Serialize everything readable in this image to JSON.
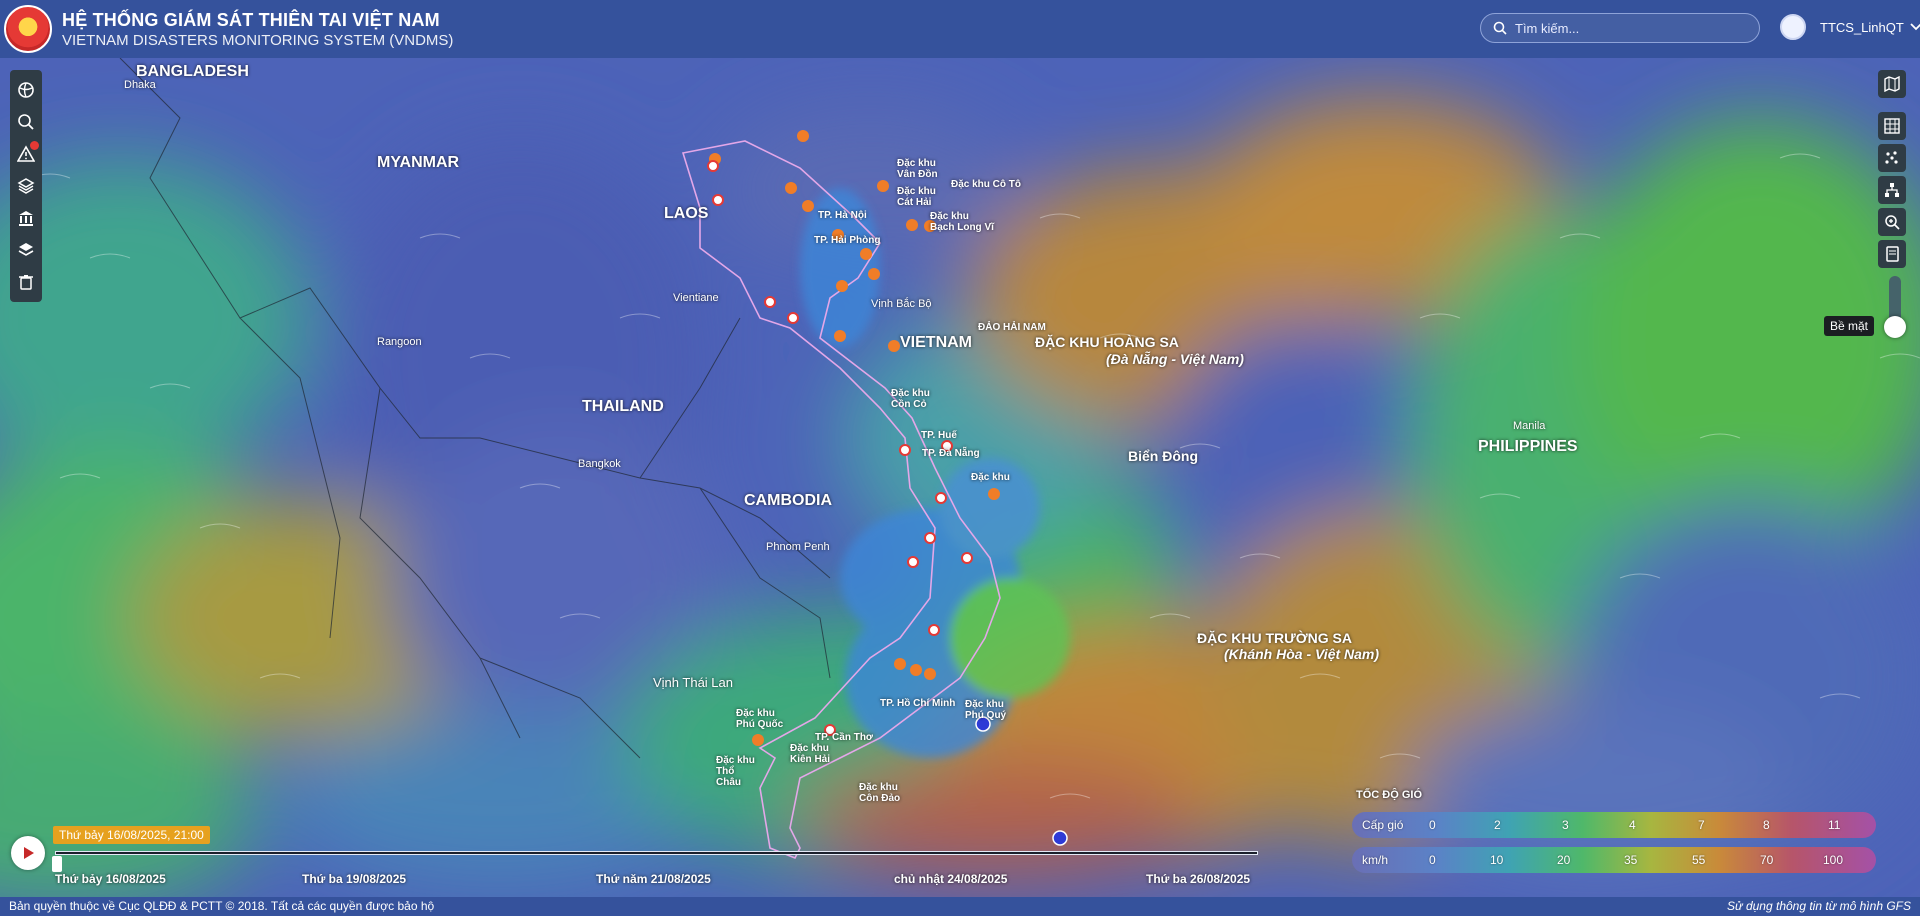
{
  "header": {
    "title": "HỆ THỐNG GIÁM SÁT THIÊN TAI VIỆT NAM",
    "subtitle": "VIETNAM DISASTERS MONITORING SYSTEM (VNDMS)",
    "search_placeholder": "Tìm kiếm...",
    "username": "TTCS_LinhQT"
  },
  "map_labels": {
    "bangladesh": "BANGLADESH",
    "dhaka": "Dhaka",
    "myanmar": "MYANMAR",
    "laos": "LAOS",
    "vientiane": "Vientiane",
    "rangoon": "Rangoon",
    "thailand": "THAILAND",
    "bangkok": "Bangkok",
    "cambodia": "CAMBODIA",
    "phnom_penh": "Phnom Penh",
    "vietnam": "VIETNAM",
    "vinh_bac_bo": "Vịnh Bắc Bộ",
    "dao_hai_nam": "ĐẢO HẢI NAM",
    "hoang_sa": "ĐẶC KHU HOÀNG SA",
    "hoang_sa_sub": "(Đà Nẵng - Việt Nam)",
    "bien_dong": "Biển Đông",
    "manila": "Manila",
    "philippines": "PHILIPPINES",
    "truong_sa": "ĐẶC KHU TRƯỜNG SA",
    "truong_sa_sub": "(Khánh Hòa - Việt Nam)",
    "vinh_thai_lan": "Vịnh Thái Lan",
    "van_don": "Đặc khu Vân Đồn",
    "co_to": "Đặc khu Cô Tô",
    "cat_hai": "Đặc khu Cát Hải",
    "bach_long_vi": "Đặc khu Bạch Long Vĩ",
    "ha_noi": "TP. Hà Nội",
    "hai_phong": "TP. Hải Phòng",
    "con_co": "Đặc khu Cồn Cỏ",
    "hue": "TP. Huế",
    "da_nang": "TP. Đà Nẵng",
    "ly_son": "Đặc khu",
    "hcm": "TP. Hồ Chí Minh",
    "phu_quy": "Đặc khu Phú Quý",
    "phu_quoc": "Đặc khu Phú Quốc",
    "can_tho": "TP. Cần Thơ",
    "kien_hai": "Đặc khu Kiên Hải",
    "tho_chau": "Đặc khu Thổ Châu",
    "con_dao": "Đặc khu Côn Đảo"
  },
  "right_panel": {
    "level_label": "Bề mặt",
    "slider_value": 0
  },
  "timeline": {
    "current": "Thứ bảy 16/08/2025, 21:00",
    "ticks": [
      "Thứ bảy 16/08/2025",
      "Thứ ba 19/08/2025",
      "Thứ năm 21/08/2025",
      "chủ nhật 24/08/2025",
      "Thứ ba 26/08/2025"
    ],
    "progress": 0
  },
  "legend": {
    "title": "TỐC ĐỘ GIÓ",
    "row1": {
      "name": "Cấp gió",
      "values": [
        "0",
        "2",
        "3",
        "4",
        "7",
        "8",
        "11"
      ]
    },
    "row2": {
      "name": "km/h",
      "values": [
        "0",
        "10",
        "20",
        "35",
        "55",
        "70",
        "100"
      ]
    }
  },
  "footer": {
    "copyright": "Bản quyền thuộc về Cục QLĐĐ & PCTT © 2018. Tất cả các quyền được bảo hộ",
    "source": "Sử dụng thông tin từ mô hình GFS"
  },
  "colors": {
    "header_bg": "#35529c",
    "toolbar_bg": "#2f3c45",
    "date_tag": "#e6a11f",
    "warning_marker": "#f07d28",
    "alert_marker": "#e53935"
  }
}
